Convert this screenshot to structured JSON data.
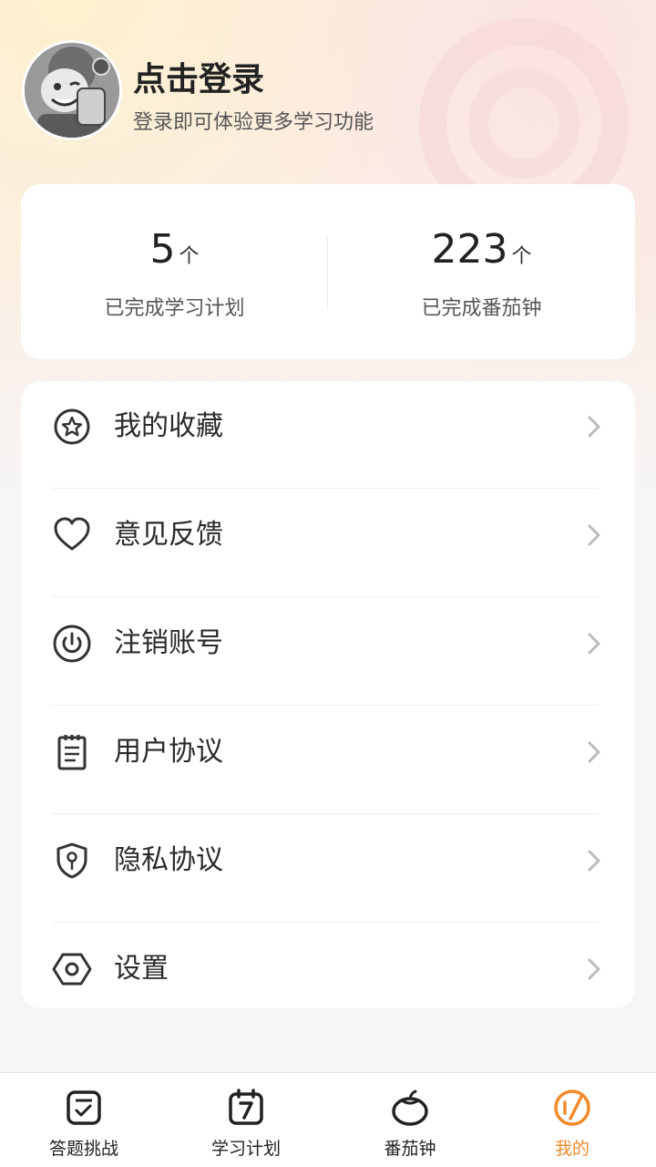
{
  "profile": {
    "title": "点击登录",
    "subtitle": "登录即可体验更多学习功能"
  },
  "stats": [
    {
      "value": "5",
      "unit": "个",
      "label": "已完成学习计划"
    },
    {
      "value": "223",
      "unit": "个",
      "label": "已完成番茄钟"
    }
  ],
  "menu": [
    {
      "label": "我的收藏",
      "icon": "star-circle-icon"
    },
    {
      "label": "意见反馈",
      "icon": "heart-icon"
    },
    {
      "label": "注销账号",
      "icon": "power-icon"
    },
    {
      "label": "用户协议",
      "icon": "notepad-icon"
    },
    {
      "label": "隐私协议",
      "icon": "shield-key-icon"
    },
    {
      "label": "设置",
      "icon": "hexagon-settings-icon"
    }
  ],
  "tabs": [
    {
      "label": "答题挑战",
      "icon": "checkbox-icon"
    },
    {
      "label": "学习计划",
      "icon": "calendar-7-icon"
    },
    {
      "label": "番茄钟",
      "icon": "tomato-icon"
    },
    {
      "label": "我的",
      "icon": "profile-orange-icon",
      "active": true
    }
  ],
  "colors": {
    "accent": "#f08a2c",
    "background": "#f6f6f6"
  }
}
